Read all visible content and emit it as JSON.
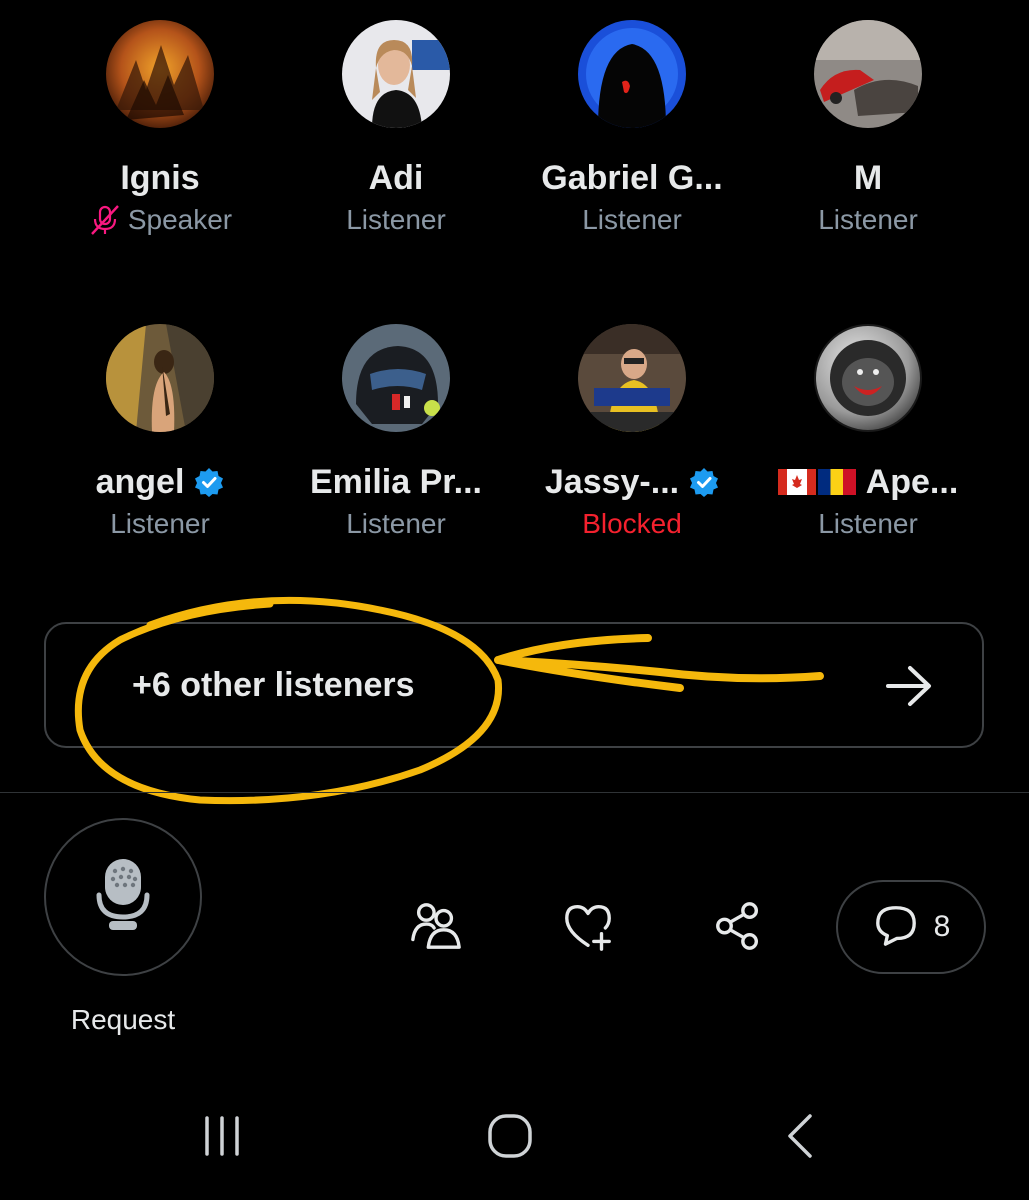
{
  "participants": [
    {
      "name": "Ignis",
      "role": "Speaker",
      "role_status": "muted",
      "verified": false
    },
    {
      "name": "Adi",
      "role": "Listener",
      "verified": false
    },
    {
      "name": "Gabriel G...",
      "role": "Listener",
      "verified": false
    },
    {
      "name": "M",
      "role": "Listener",
      "verified": false
    },
    {
      "name": "angel",
      "role": "Listener",
      "verified": true
    },
    {
      "name": "Emilia Pr...",
      "role": "Listener",
      "verified": false
    },
    {
      "name": "Jassy-...",
      "role": "Blocked",
      "verified": true
    },
    {
      "name": "Ape...",
      "role": "Listener",
      "verified": false,
      "flags": [
        "canada-flag",
        "romania-flag"
      ]
    }
  ],
  "listeners_bar": {
    "label": "+6 other listeners",
    "arrow_icon": "arrow-right-icon"
  },
  "annotation": {
    "color": "#f5b80c"
  },
  "controls": {
    "mic_icon": "microphone-icon",
    "request_label": "Request",
    "people_icon": "people-icon",
    "like_icon": "heart-plus-icon",
    "share_icon": "share-icon",
    "chat_icon": "chat-bubble-icon",
    "chat_count": "8"
  },
  "system_nav": {
    "recents_icon": "recents-icon",
    "home_icon": "home-icon",
    "back_icon": "back-icon"
  },
  "colors": {
    "background": "#000000",
    "text_primary": "#e7e9ea",
    "text_secondary": "#8b98a5",
    "blocked": "#f4212e",
    "verified": "#1d9bf0",
    "muted_mic": "#f91880",
    "border": "#3e4144"
  }
}
